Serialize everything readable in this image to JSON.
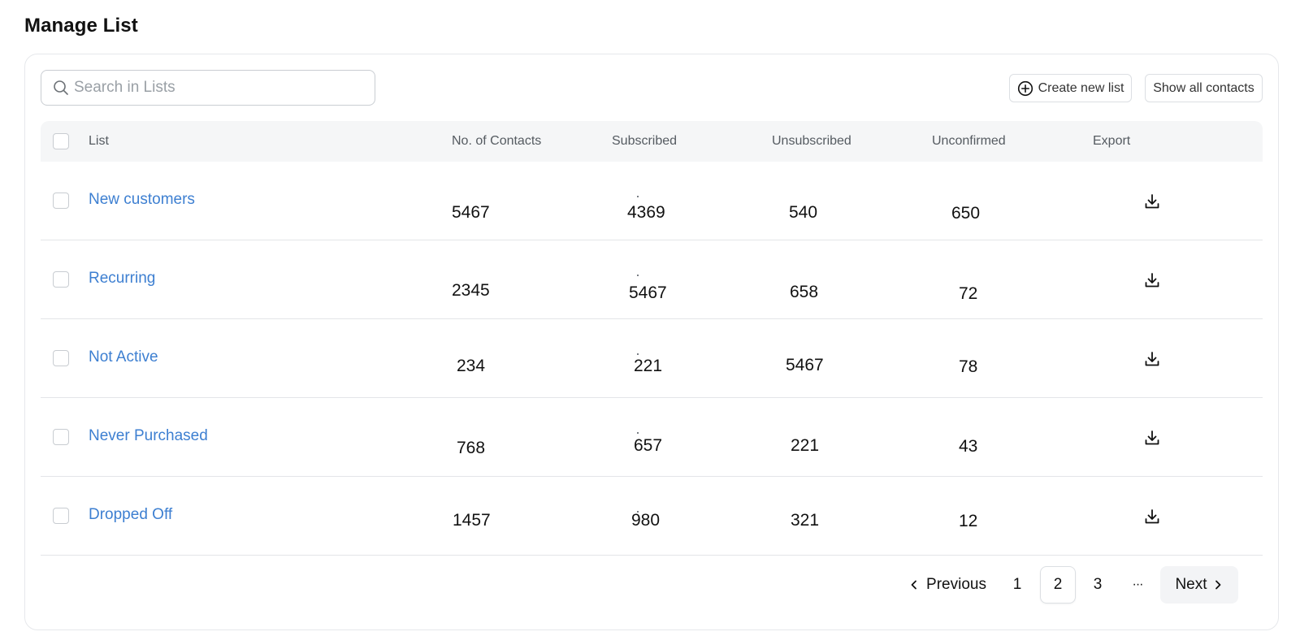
{
  "page": {
    "title": "Manage List"
  },
  "search": {
    "placeholder": "Search in Lists",
    "value": ""
  },
  "toolbar": {
    "create_label": "Create new list",
    "show_all_label": "Show all contacts"
  },
  "table": {
    "headers": {
      "list": "List",
      "contacts": "No. of Contacts",
      "subscribed": "Subscribed",
      "unsubscribed": "Unsubscribed",
      "unconfirmed": "Unconfirmed",
      "export": "Export"
    },
    "rows": [
      {
        "name": "New customers",
        "contacts": "5467",
        "subscribed": "4369",
        "unsubscribed": "540",
        "unconfirmed": "650"
      },
      {
        "name": "Recurring",
        "contacts": "2345",
        "subscribed": "5467",
        "unsubscribed": "658",
        "unconfirmed": "72"
      },
      {
        "name": "Not Active",
        "contacts": "234",
        "subscribed": "221",
        "unsubscribed": "5467",
        "unconfirmed": "78"
      },
      {
        "name": "Never Purchased",
        "contacts": "768",
        "subscribed": "657",
        "unsubscribed": "221",
        "unconfirmed": "43"
      },
      {
        "name": "Dropped Off",
        "contacts": "1457",
        "subscribed": "980",
        "unsubscribed": "321",
        "unconfirmed": "12"
      }
    ]
  },
  "pagination": {
    "previous_label": "Previous",
    "next_label": "Next",
    "pages": [
      "1",
      "2",
      "3"
    ],
    "current_page": "2",
    "ellipsis": "···"
  },
  "icons": {
    "search": "search-icon",
    "create": "plus-circle-icon",
    "export": "download-icon",
    "previous": "chevron-left-icon",
    "next": "chevron-right-icon"
  },
  "colors": {
    "link": "#3d7fd1",
    "header_bg": "#f5f6f7",
    "border": "#e3e5e8"
  }
}
